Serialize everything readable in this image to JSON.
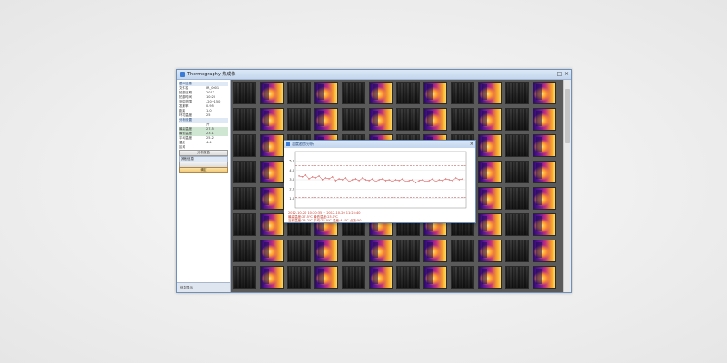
{
  "window": {
    "title": "Thermography 热成像",
    "controls": [
      "–",
      "□",
      "×"
    ]
  },
  "left_panel": {
    "rows": [
      {
        "label": "基本信息",
        "value": "",
        "style": "header"
      },
      {
        "label": "文件名",
        "value": "IR_0001",
        "style": ""
      },
      {
        "label": "拍摄日期",
        "value": "2012",
        "style": ""
      },
      {
        "label": "拍摄时间",
        "value": "10:20",
        "style": ""
      },
      {
        "label": "测温范围",
        "value": "-20~150",
        "style": ""
      },
      {
        "label": "发射率",
        "value": "0.95",
        "style": ""
      },
      {
        "label": "距离",
        "value": "1.0",
        "style": ""
      },
      {
        "label": "环境温度",
        "value": "25",
        "style": ""
      },
      {
        "label": "分析设置",
        "value": "",
        "style": "header"
      },
      {
        "label": "",
        "value": "开",
        "style": ""
      },
      {
        "label": "最高温度",
        "value": "27.5",
        "style": "selected"
      },
      {
        "label": "最低温度",
        "value": "23.1",
        "style": "selected"
      },
      {
        "label": "平均温度",
        "value": "25.2",
        "style": ""
      },
      {
        "label": "温差",
        "value": "4.4",
        "style": ""
      },
      {
        "label": "区域",
        "value": "",
        "style": ""
      }
    ],
    "buttons": [
      {
        "label": "分析报告",
        "kind": "plain"
      },
      {
        "label": "其他信息",
        "kind": "section"
      },
      {
        "label": "",
        "kind": "plain-small"
      },
      {
        "label": "确定",
        "kind": "accent"
      }
    ],
    "footer": "信息显示"
  },
  "grid": {
    "columns": 12,
    "rows": 8,
    "pattern": [
      "gray",
      "thermal",
      "gray",
      "thermal",
      "gray",
      "thermal",
      "gray",
      "thermal",
      "gray",
      "thermal",
      "gray",
      "thermal"
    ]
  },
  "dialog": {
    "title": "温度趋势分析",
    "close": "×",
    "chart_data": {
      "type": "line",
      "title": "",
      "xlabel": "",
      "ylabel": "",
      "ylim": [
        0,
        6
      ],
      "y_ticks": [
        "5.0",
        "4.0",
        "3.0",
        "2.0",
        "1.0"
      ],
      "reference_lines": [
        4.5,
        1.1
      ],
      "series": [
        {
          "color": "#d43a3a",
          "values": [
            3.4,
            3.3,
            3.5,
            3.1,
            3.3,
            3.2,
            3.4,
            3.0,
            3.2,
            3.1,
            3.3,
            2.9,
            3.1,
            3.0,
            3.2,
            2.8,
            3.0,
            3.1,
            2.9,
            3.2,
            3.0,
            2.9,
            3.1,
            2.8,
            3.0,
            3.1,
            2.9,
            3.0,
            2.8,
            3.0,
            2.9,
            3.1,
            2.8,
            2.9,
            3.0,
            2.7,
            2.9,
            3.0,
            2.8,
            2.9,
            3.1,
            2.8,
            3.0,
            2.9,
            3.1,
            3.0,
            2.9,
            3.2,
            3.0,
            3.1
          ]
        }
      ]
    },
    "info_lines": [
      {
        "text": "2012-10-20 10:20:35 ~ 2012-10-20 11:25:40",
        "color": "#c0392b"
      },
      {
        "text": "最高温度:27.5℃   最低温度:23.1℃",
        "color": "#c0392b"
      },
      {
        "text": "当前温度:25.2℃  平均:25.0℃  温差:4.4℃  点数:50",
        "color": "#c0392b"
      }
    ]
  },
  "colors": {
    "window_border": "#6d8fb8",
    "titlebar": "#c4d6ec",
    "accent_button": "#f1c46b",
    "grid_bg": "#5a5a5a",
    "line_series": "#d43a3a"
  }
}
